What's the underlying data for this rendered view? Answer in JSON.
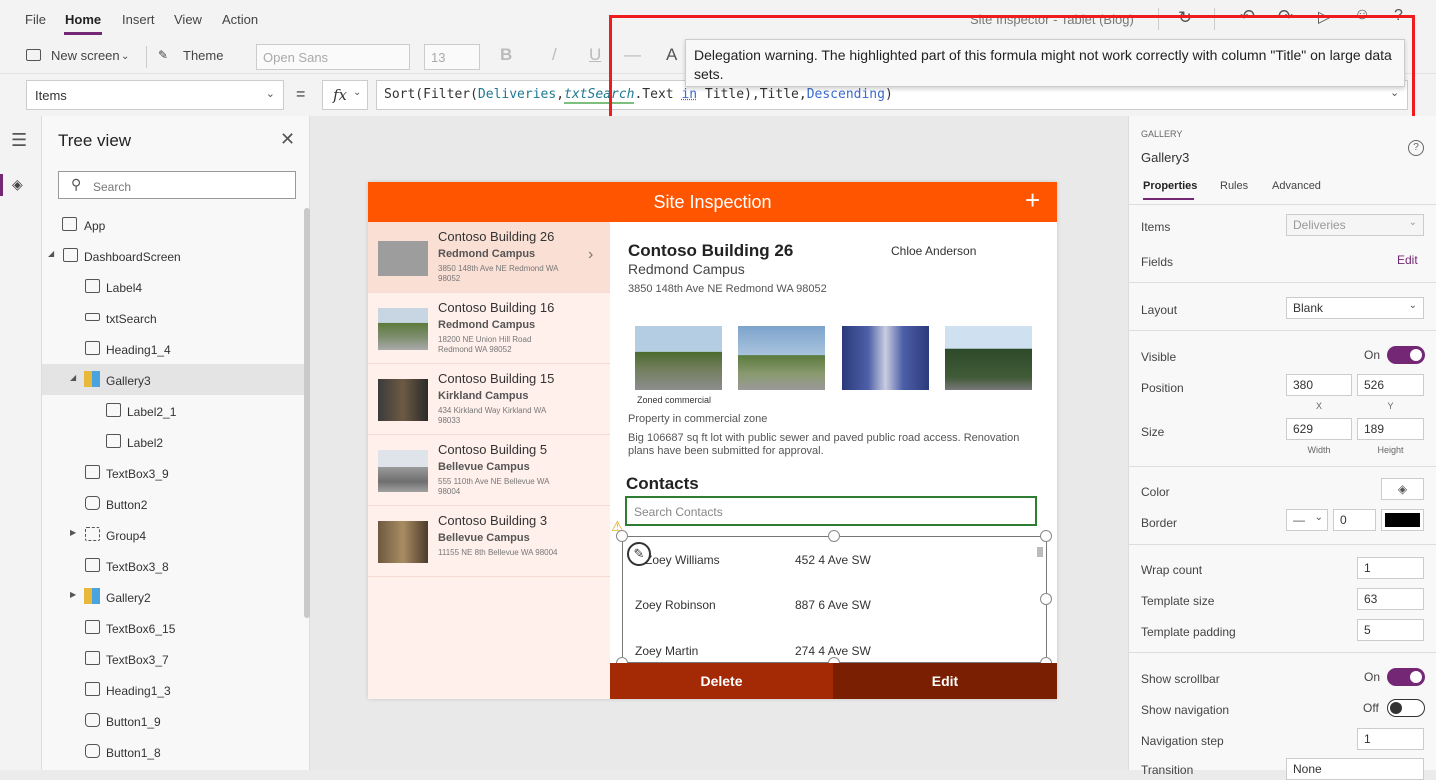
{
  "menu": {
    "items": [
      "File",
      "Home",
      "Insert",
      "View",
      "Action"
    ],
    "active": "Home"
  },
  "toolbar": {
    "new_screen": "New screen",
    "theme": "Theme",
    "font": "Open Sans",
    "font_size": "13",
    "bold": "B",
    "italic": "/",
    "underline": "U",
    "strike": "—",
    "font_color": "A"
  },
  "title": {
    "app_name": "Site Inspector - Tablet (Blog)"
  },
  "formula": {
    "property": "Items",
    "equals": "=",
    "fx": "fx",
    "parts": {
      "p1": "Sort(Filter(",
      "p2": "Deliveries",
      "p3": ",",
      "p4": "txtSearch",
      "p5": ".Text ",
      "p6": "in",
      "p7": " Title),Title,",
      "p8": "Descending",
      "p9": ")"
    }
  },
  "tooltip": {
    "text": "Delegation warning. The highlighted part of this formula might not work correctly with column \"Title\" on large data sets."
  },
  "tree": {
    "title": "Tree view",
    "search_placeholder": "Search",
    "items": [
      "App",
      "DashboardScreen",
      "Label4",
      "txtSearch",
      "Heading1_4",
      "Gallery3",
      "Label2_1",
      "Label2",
      "TextBox3_9",
      "Button2",
      "Group4",
      "TextBox3_8",
      "Gallery2",
      "TextBox6_15",
      "TextBox3_7",
      "Heading1_3",
      "Button1_9",
      "Button1_8"
    ]
  },
  "app": {
    "header": "Site Inspection",
    "add": "+",
    "list": [
      {
        "title": "Contoso Building 26",
        "campus": "Redmond Campus",
        "address": "3850 148th Ave NE Redmond WA 98052"
      },
      {
        "title": "Contoso Building 16",
        "campus": "Redmond Campus",
        "address": "18200 NE Union Hill Road Redmond WA 98052"
      },
      {
        "title": "Contoso Building 15",
        "campus": "Kirkland Campus",
        "address": "434 Kirkland Way Kirkland WA 98033"
      },
      {
        "title": "Contoso Building 5",
        "campus": "Bellevue Campus",
        "address": "555 110th Ave NE Bellevue WA 98004"
      },
      {
        "title": "Contoso Building 3",
        "campus": "Bellevue Campus",
        "address": "11155 NE 8th Bellevue WA 98004"
      }
    ],
    "detail": {
      "title": "Contoso Building 26",
      "campus": "Redmond Campus",
      "address": "3850 148th Ave NE Redmond WA 98052",
      "inspector": "Chloe Anderson",
      "photo_caption": "Zoned commercial",
      "zone": "Property in commercial zone",
      "description": "Big 106687 sq ft lot with public sewer and paved public road access. Renovation plans have been submitted for approval.",
      "contacts_heading": "Contacts",
      "contacts_placeholder": "Search Contacts",
      "contacts": [
        {
          "name": "Zoey Williams",
          "address": "452  4 Ave SW"
        },
        {
          "name": "Zoey Robinson",
          "address": "887  6 Ave SW"
        },
        {
          "name": "Zoey Martin",
          "address": "274  4 Ave SW"
        }
      ]
    },
    "delete": "Delete",
    "edit": "Edit"
  },
  "props": {
    "type": "GALLERY",
    "name": "Gallery3",
    "tabs": [
      "Properties",
      "Rules",
      "Advanced"
    ],
    "items_label": "Items",
    "items_value": "Deliveries",
    "fields_label": "Fields",
    "fields_edit": "Edit",
    "layout_label": "Layout",
    "layout_value": "Blank",
    "visible_label": "Visible",
    "visible_value": "On",
    "position_label": "Position",
    "pos_x": "380",
    "pos_y": "526",
    "x_caption": "X",
    "y_caption": "Y",
    "size_label": "Size",
    "width": "629",
    "height": "189",
    "width_caption": "Width",
    "height_caption": "Height",
    "color_label": "Color",
    "border_label": "Border",
    "border_value": "0",
    "wrap_label": "Wrap count",
    "wrap_value": "1",
    "template_size_label": "Template size",
    "template_size_value": "63",
    "template_padding_label": "Template padding",
    "template_padding_value": "5",
    "scrollbar_label": "Show scrollbar",
    "scrollbar_value": "On",
    "navigation_label": "Show navigation",
    "navigation_value": "Off",
    "navstep_label": "Navigation step",
    "navstep_value": "1",
    "transition_label": "Transition",
    "transition_value": "None"
  },
  "colors": {
    "accent": "#742774",
    "header": "#ff5500",
    "delete": "#a42a06",
    "edit": "#7a1f02",
    "warning_box": "#ee1c1c"
  }
}
